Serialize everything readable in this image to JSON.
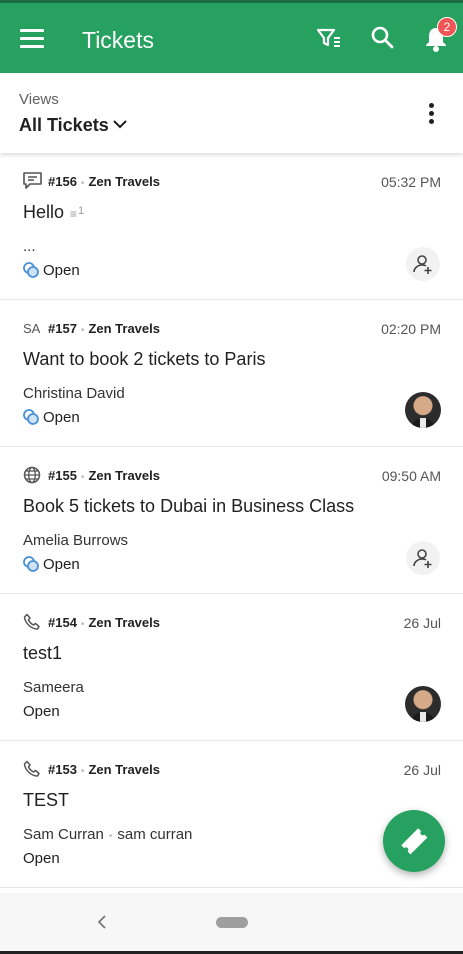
{
  "app_bar": {
    "title": "Tickets",
    "notification_count": "2",
    "icons": [
      "menu-icon",
      "filter-icon",
      "search-icon",
      "bell-icon"
    ]
  },
  "views": {
    "caption": "Views",
    "current": "All Tickets"
  },
  "tickets": [
    {
      "type_icon": "chat-icon",
      "number": "#156",
      "company": "Zen Travels",
      "time": "05:32 PM",
      "subject": "Hello",
      "note_count": "1",
      "requester": "...",
      "status": "Open",
      "assignee": "assign-button"
    },
    {
      "type_label": "SA",
      "number": "#157",
      "company": "Zen Travels",
      "time": "02:20 PM",
      "subject": "Want to book 2 tickets to Paris",
      "requester": "Christina David",
      "status": "Open",
      "assignee": "avatar"
    },
    {
      "type_icon": "globe-icon",
      "number": "#155",
      "company": "Zen Travels",
      "time": "09:50 AM",
      "subject": "Book 5 tickets to Dubai in Business Class",
      "requester": "Amelia Burrows",
      "status": "Open",
      "assignee": "assign-button"
    },
    {
      "type_icon": "phone-icon",
      "number": "#154",
      "company": "Zen Travels",
      "time": "26 Jul",
      "subject": "test1",
      "requester": "Sameera",
      "status": "Open",
      "assignee": "avatar"
    },
    {
      "type_icon": "phone-icon",
      "number": "#153",
      "company": "Zen Travels",
      "time": "26 Jul",
      "subject": "TEST",
      "requester": "Sam Curran",
      "requester_secondary": "sam curran",
      "status": "Open"
    }
  ],
  "colors": {
    "brand_green": "#27a160",
    "badge_red": "#f05454",
    "status_blue": "#4a90d9"
  }
}
